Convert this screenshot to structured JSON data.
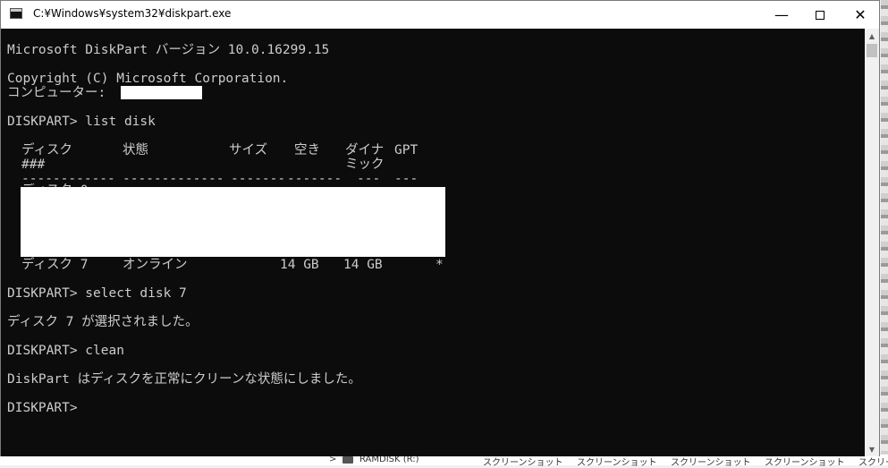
{
  "window": {
    "title": "C:¥Windows¥system32¥diskpart.exe",
    "minimize_glyph": "—",
    "close_glyph": "✕"
  },
  "console": {
    "version_line": "Microsoft DiskPart バージョン 10.0.16299.15",
    "copyright_line": "Copyright (C) Microsoft Corporation.",
    "computer_label": "コンピューター: ",
    "cmd_list_disk": "DISKPART> list disk",
    "table": {
      "headers": [
        "ディスク",
        "状態",
        "サイズ",
        "空き",
        "ダイナ",
        "GPT"
      ],
      "header_row2": [
        "###",
        "ミック"
      ],
      "separators": [
        "------------",
        "-------------",
        "-------",
        "-------",
        "---",
        "---"
      ],
      "row": {
        "disk": "ディスク 7",
        "status": "オンライン",
        "size": "14 GB",
        "free": "14 GB",
        "dyn": "",
        "gpt": "*"
      },
      "partial_row_visible": "ディスク 0"
    },
    "cmd_select": "DISKPART> select disk 7",
    "select_result": "ディスク 7 が選択されました。",
    "cmd_clean": "DISKPART> clean",
    "clean_result": "DiskPart はディスクを正常にクリーンな状態にしました。",
    "prompt": "DISKPART>"
  },
  "scrollbar": {
    "up_glyph": "▲",
    "down_glyph": "▼"
  },
  "background": {
    "drive_label": "RAMDISK (R:)",
    "screenshot_labels": [
      "スクリーンショット",
      "スクリーンショット",
      "スクリーンショット",
      "スクリーンショット",
      "スクリー"
    ],
    "expand_glyph": ">"
  },
  "colors": {
    "console_bg": "#0c0c0c",
    "console_fg": "#cccccc",
    "titlebar_bg": "#ffffff"
  }
}
